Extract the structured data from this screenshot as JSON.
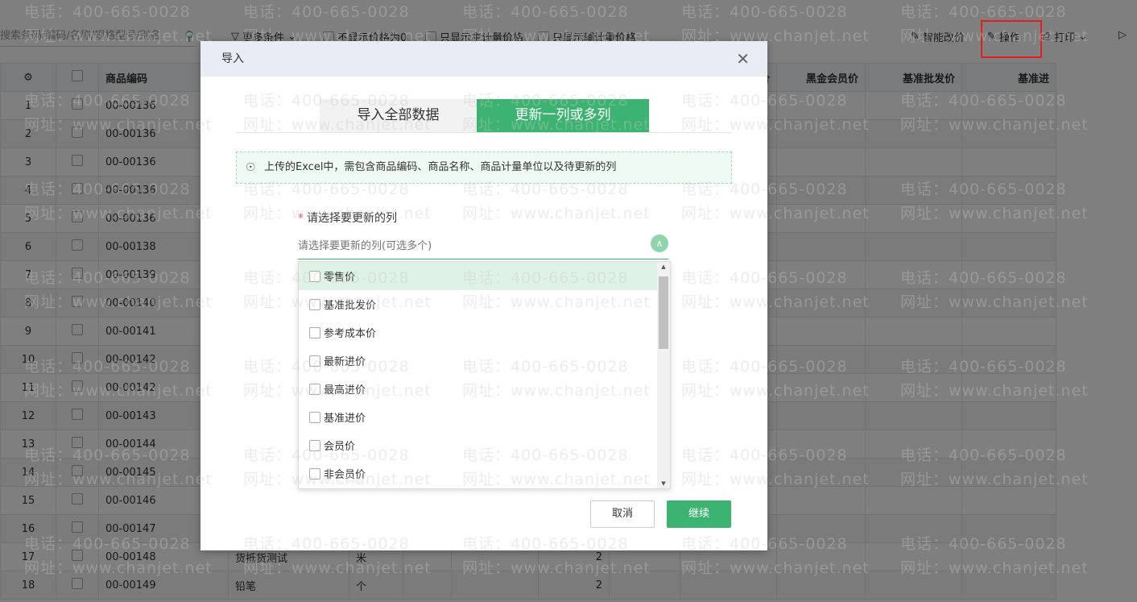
{
  "toolbar": {
    "search_placeholder": "搜索条码/编码/名称/规格型号/别名",
    "more": "更多条件",
    "check1": "不显示价格为0",
    "check2": "只显示主计量价格",
    "check3": "只显示辅计量价格",
    "smart_price": "智能改价",
    "operate": "操作",
    "print": "打印"
  },
  "table": {
    "headers": [
      "",
      "",
      "商品编码",
      "",
      "",
      "",
      "",
      "",
      "",
      "白金会员价",
      "黑金会员价",
      "基准批发价",
      "基准进"
    ],
    "rows": [
      {
        "no": "1",
        "code": "00-00136",
        "name": "",
        "unit": "",
        "qty": ""
      },
      {
        "no": "2",
        "code": "00-00136",
        "name": "",
        "unit": "",
        "qty": ""
      },
      {
        "no": "3",
        "code": "00-00136",
        "name": "",
        "unit": "",
        "qty": ""
      },
      {
        "no": "4",
        "code": "00-00136",
        "name": "",
        "unit": "",
        "qty": ""
      },
      {
        "no": "5",
        "code": "00-00136",
        "name": "",
        "unit": "",
        "qty": ""
      },
      {
        "no": "6",
        "code": "00-00138",
        "name": "",
        "unit": "",
        "qty": ""
      },
      {
        "no": "7",
        "code": "00-00139",
        "name": "",
        "unit": "",
        "qty": ""
      },
      {
        "no": "8",
        "code": "00-00140",
        "name": "",
        "unit": "",
        "qty": ""
      },
      {
        "no": "9",
        "code": "00-00141",
        "name": "",
        "unit": "",
        "qty": ""
      },
      {
        "no": "10",
        "code": "00-00142",
        "name": "",
        "unit": "",
        "qty": ""
      },
      {
        "no": "11",
        "code": "00-00142",
        "name": "",
        "unit": "",
        "qty": ""
      },
      {
        "no": "12",
        "code": "00-00143",
        "name": "",
        "unit": "",
        "qty": ""
      },
      {
        "no": "13",
        "code": "00-00144",
        "name": "",
        "unit": "",
        "qty": ""
      },
      {
        "no": "14",
        "code": "00-00145",
        "name": "",
        "unit": "",
        "qty": ""
      },
      {
        "no": "15",
        "code": "00-00146",
        "name": "",
        "unit": "",
        "qty": ""
      },
      {
        "no": "16",
        "code": "00-00147",
        "name": "",
        "unit": "",
        "qty": ""
      },
      {
        "no": "17",
        "code": "00-00148",
        "name": "货抵货测试",
        "unit": "米",
        "qty": "2"
      },
      {
        "no": "18",
        "code": "00-00149",
        "name": "铅笔",
        "unit": "个",
        "qty": "2"
      }
    ]
  },
  "modal": {
    "title": "导入",
    "tabs": [
      "导入全部数据",
      "更新一列或多列"
    ],
    "active_tab": 1,
    "info": "上传的Excel中，需包含商品编码、商品名称、商品计量单位以及待更新的列",
    "field_label": "请选择要更新的列",
    "placeholder": "请选择要更新的列(可选多个)",
    "options": [
      "零售价",
      "基准批发价",
      "参考成本价",
      "最新进价",
      "最高进价",
      "基准进价",
      "会员价",
      "非会员价"
    ],
    "cancel": "取消",
    "continue": "继续"
  },
  "watermark": {
    "phone": "电话：400-665-0028",
    "site": "网址：www.chanjet.net"
  },
  "colors": {
    "accent": "#3cb371",
    "highlight": "#e02020"
  }
}
